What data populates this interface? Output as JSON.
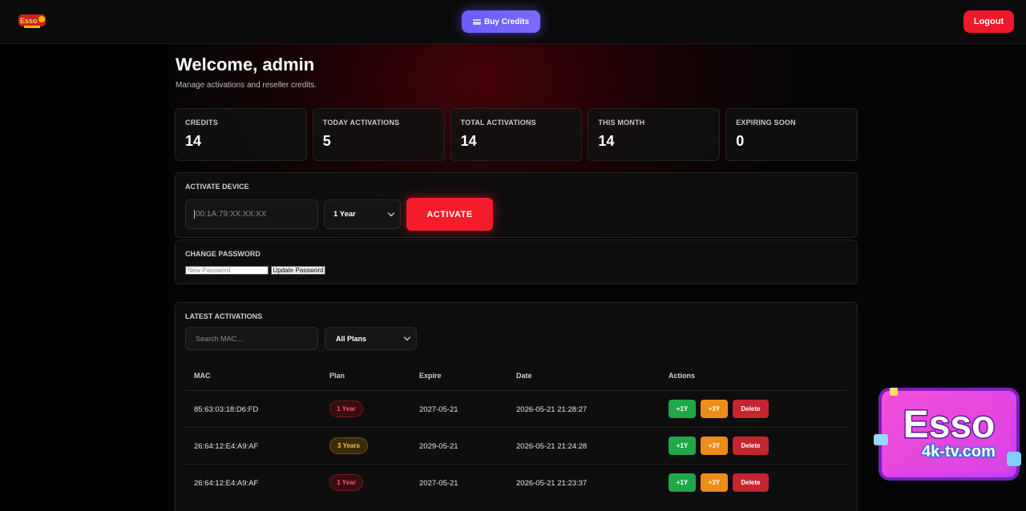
{
  "header": {
    "buy_credits_label": "Buy Credits",
    "logout_label": "Logout",
    "logo_text": "Esso"
  },
  "welcome": {
    "title": "Welcome, admin",
    "subtitle": "Manage activations and reseller credits."
  },
  "stats": [
    {
      "label": "CREDITS",
      "value": "14"
    },
    {
      "label": "TODAY ACTIVATIONS",
      "value": "5"
    },
    {
      "label": "TOTAL ACTIVATIONS",
      "value": "14"
    },
    {
      "label": "THIS MONTH",
      "value": "14"
    },
    {
      "label": "EXPIRING SOON",
      "value": "0"
    }
  ],
  "activate": {
    "title": "ACTIVATE DEVICE",
    "mac_placeholder": "00:1A:79:XX:XX:XX",
    "plan_value": "1 Year",
    "button_label": "ACTIVATE"
  },
  "password": {
    "title": "CHANGE PASSWORD",
    "placeholder": "New Password",
    "button_label": "Update Password"
  },
  "activations": {
    "title": "LATEST ACTIVATIONS",
    "search_placeholder": "Search MAC...",
    "filter_value": "All Plans",
    "columns": [
      "MAC",
      "Plan",
      "Expire",
      "Date",
      "Actions"
    ],
    "rows": [
      {
        "mac": "85:63:03:18:D6:FD",
        "plan": "1 Year",
        "expire": "2027-05-21",
        "date": "2026-05-21 21:28:27"
      },
      {
        "mac": "26:64:12:E4:A9:AF",
        "plan": "3 Years",
        "expire": "2029-05-21",
        "date": "2026-05-21 21:24:28"
      },
      {
        "mac": "26:64:12:E4:A9:AF",
        "plan": "1 Year",
        "expire": "2027-05-21",
        "date": "2026-05-21 21:23:37"
      }
    ],
    "actions": {
      "plus1": "+1Y",
      "plus3": "+3Y",
      "delete": "Delete"
    }
  },
  "promo": {
    "brand": "Esso",
    "domain": "4k-tv.com"
  },
  "colors": {
    "accent_red": "#f51d2b",
    "accent_purple": "#6a5cff",
    "green": "#1fa84a",
    "orange": "#ec8d18"
  }
}
